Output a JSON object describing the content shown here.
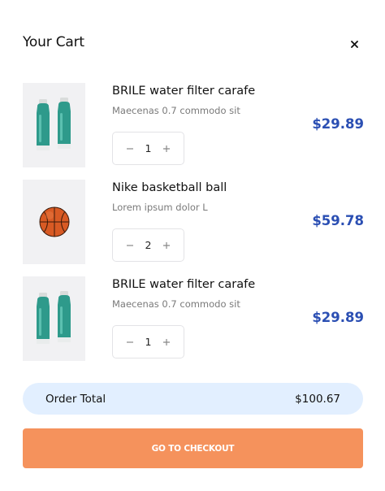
{
  "header": {
    "title": "Your Cart",
    "close_icon": "close-icon"
  },
  "items": [
    {
      "name": "BRILE water filter carafe",
      "description": "Maecenas 0.7 commodo sit",
      "quantity": "1",
      "price": "$29.89",
      "image_icon": "water-bottle-image"
    },
    {
      "name": "Nike basketball ball",
      "description": "Lorem ipsum dolor L",
      "quantity": "2",
      "price": "$59.78",
      "image_icon": "basketball-image"
    },
    {
      "name": "BRILE water filter carafe",
      "description": "Maecenas 0.7 commodo sit",
      "quantity": "1",
      "price": "$29.89",
      "image_icon": "water-bottle-image"
    }
  ],
  "summary": {
    "label": "Order Total",
    "value": "$100.67"
  },
  "checkout": {
    "label": "GO TO CHECKOUT"
  },
  "colors": {
    "accent_price": "#2b4fb3",
    "total_bg": "#e2efff",
    "checkout_bg": "#f5925c"
  }
}
